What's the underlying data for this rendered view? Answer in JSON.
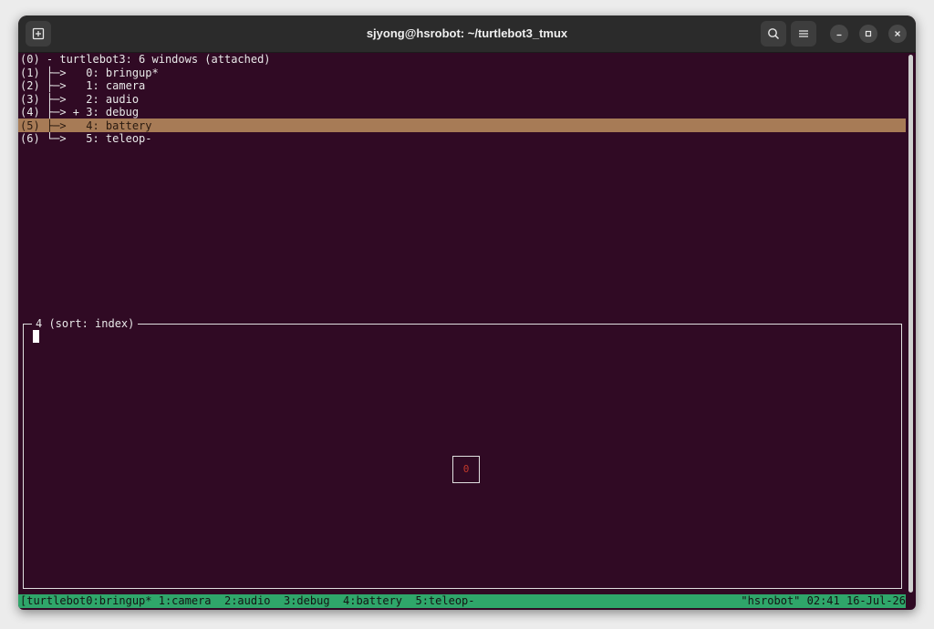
{
  "window": {
    "title": "sjyong@hsrobot: ~/turtlebot3_tmux"
  },
  "titlebar_icons": {
    "new_tab": "new-tab-icon",
    "search": "search-icon",
    "menu": "hamburger-menu-icon",
    "minimize": "minimize-icon",
    "maximize": "maximize-icon",
    "close": "close-icon"
  },
  "tree": {
    "lines": [
      "(0) - turtlebot3: 6 windows (attached)",
      "(1) ├─>   0: bringup*",
      "(2) ├─>   1: camera",
      "(3) ├─>   2: audio",
      "(4) ├─> + 3: debug",
      "(5) ├─>   4: battery",
      "(6) └─>   5: teleop-"
    ],
    "selected_index": 5
  },
  "preview": {
    "label": "4 (sort: index)",
    "pane_number": "0"
  },
  "statusbar": {
    "left": "[turtlebot0:bringup* 1:camera  2:audio  3:debug  4:battery  5:teleop-",
    "right": "\"hsrobot\" 02:41 16-Jul-26"
  },
  "colors": {
    "terminal_bg": "#300a24",
    "highlight": "#a77b56",
    "statusbar": "#2fa66a",
    "titlebar": "#2b2b2b"
  }
}
